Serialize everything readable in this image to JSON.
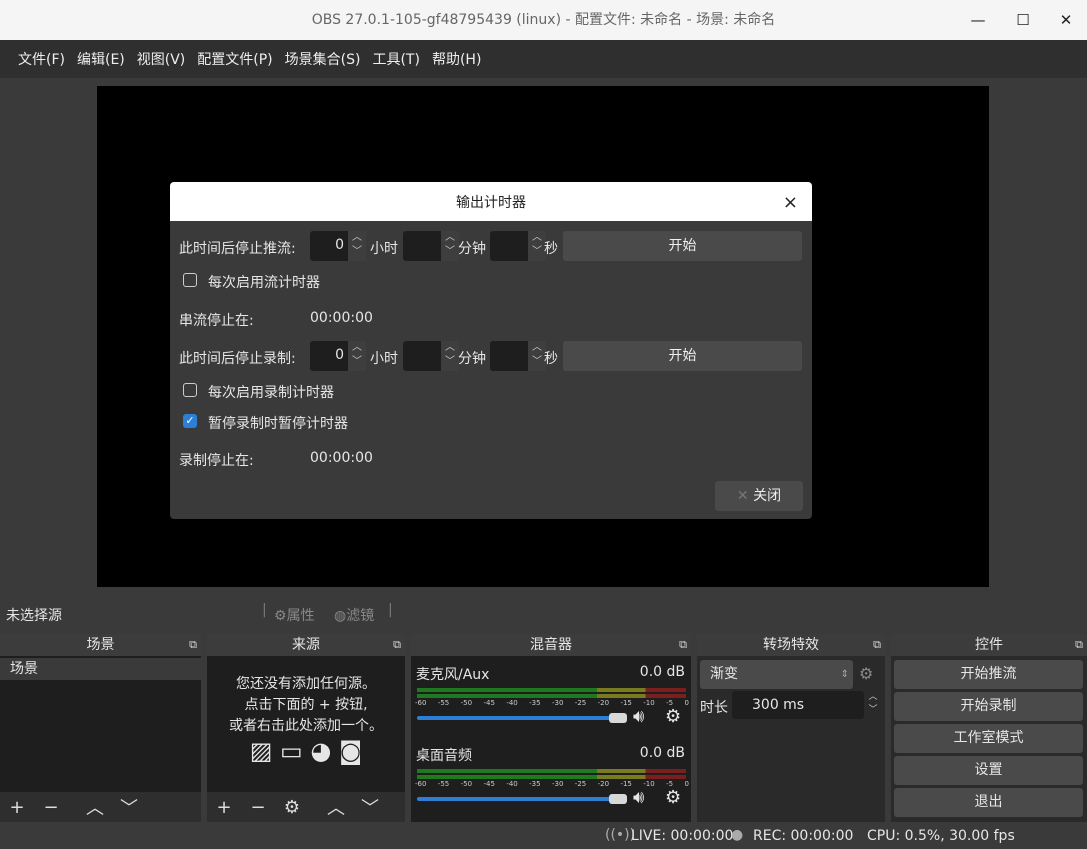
{
  "window": {
    "title": "OBS 27.0.1-105-gf48795439 (linux) - 配置文件: 未命名 - 场景: 未命名",
    "minimize": "—",
    "maximize": "☐",
    "close": "✕"
  },
  "menu": [
    "文件(F)",
    "编辑(E)",
    "视图(V)",
    "配置文件(P)",
    "场景集合(S)",
    "工具(T)",
    "帮助(H)"
  ],
  "dialog": {
    "title": "输出计时器",
    "close": "×",
    "stream": {
      "label": "此时间后停止推流:",
      "hours": "0",
      "hours_unit": "小时",
      "minutes": "",
      "minutes_unit": "分钟",
      "seconds": "",
      "seconds_unit": "秒",
      "start": "开始",
      "auto_label": "每次启用流计时器",
      "auto_checked": false,
      "stop_label": "串流停止在:",
      "stop_time": "00:00:00"
    },
    "record": {
      "label": "此时间后停止录制:",
      "hours": "0",
      "hours_unit": "小时",
      "minutes": "",
      "minutes_unit": "分钟",
      "seconds": "",
      "seconds_unit": "秒",
      "start": "开始",
      "auto_label": "每次启用录制计时器",
      "auto_checked": false,
      "pause_label": "暂停录制时暂停计时器",
      "pause_checked": true,
      "stop_label": "录制停止在:",
      "stop_time": "00:00:00"
    },
    "close_btn": "关闭"
  },
  "source_bar": {
    "no_source": "未选择源",
    "properties": "属性",
    "filters": "滤镜"
  },
  "scenes": {
    "title": "场景",
    "items": [
      "场景"
    ]
  },
  "sources": {
    "title": "来源",
    "empty": [
      "您还没有添加任何源。",
      "点击下面的 + 按钮,",
      "或者右击此处添加一个。"
    ]
  },
  "mixer": {
    "title": "混音器",
    "ticks": [
      "-60",
      "-55",
      "-50",
      "-45",
      "-40",
      "-35",
      "-30",
      "-25",
      "-20",
      "-15",
      "-10",
      "-5",
      "0"
    ],
    "channels": [
      {
        "name": "麦克风/Aux",
        "db": "0.0 dB",
        "volume": 1.0
      },
      {
        "name": "桌面音频",
        "db": "0.0 dB",
        "volume": 1.0
      }
    ]
  },
  "transitions": {
    "title": "转场特效",
    "selected": "渐变",
    "duration_label": "时长",
    "duration": "300 ms"
  },
  "controls": {
    "title": "控件",
    "buttons": [
      "开始推流",
      "开始录制",
      "工作室模式",
      "设置",
      "退出"
    ]
  },
  "status": {
    "live": "LIVE: 00:00:00",
    "rec": "REC: 00:00:00",
    "cpu": "CPU: 0.5%, 30.00 fps"
  }
}
